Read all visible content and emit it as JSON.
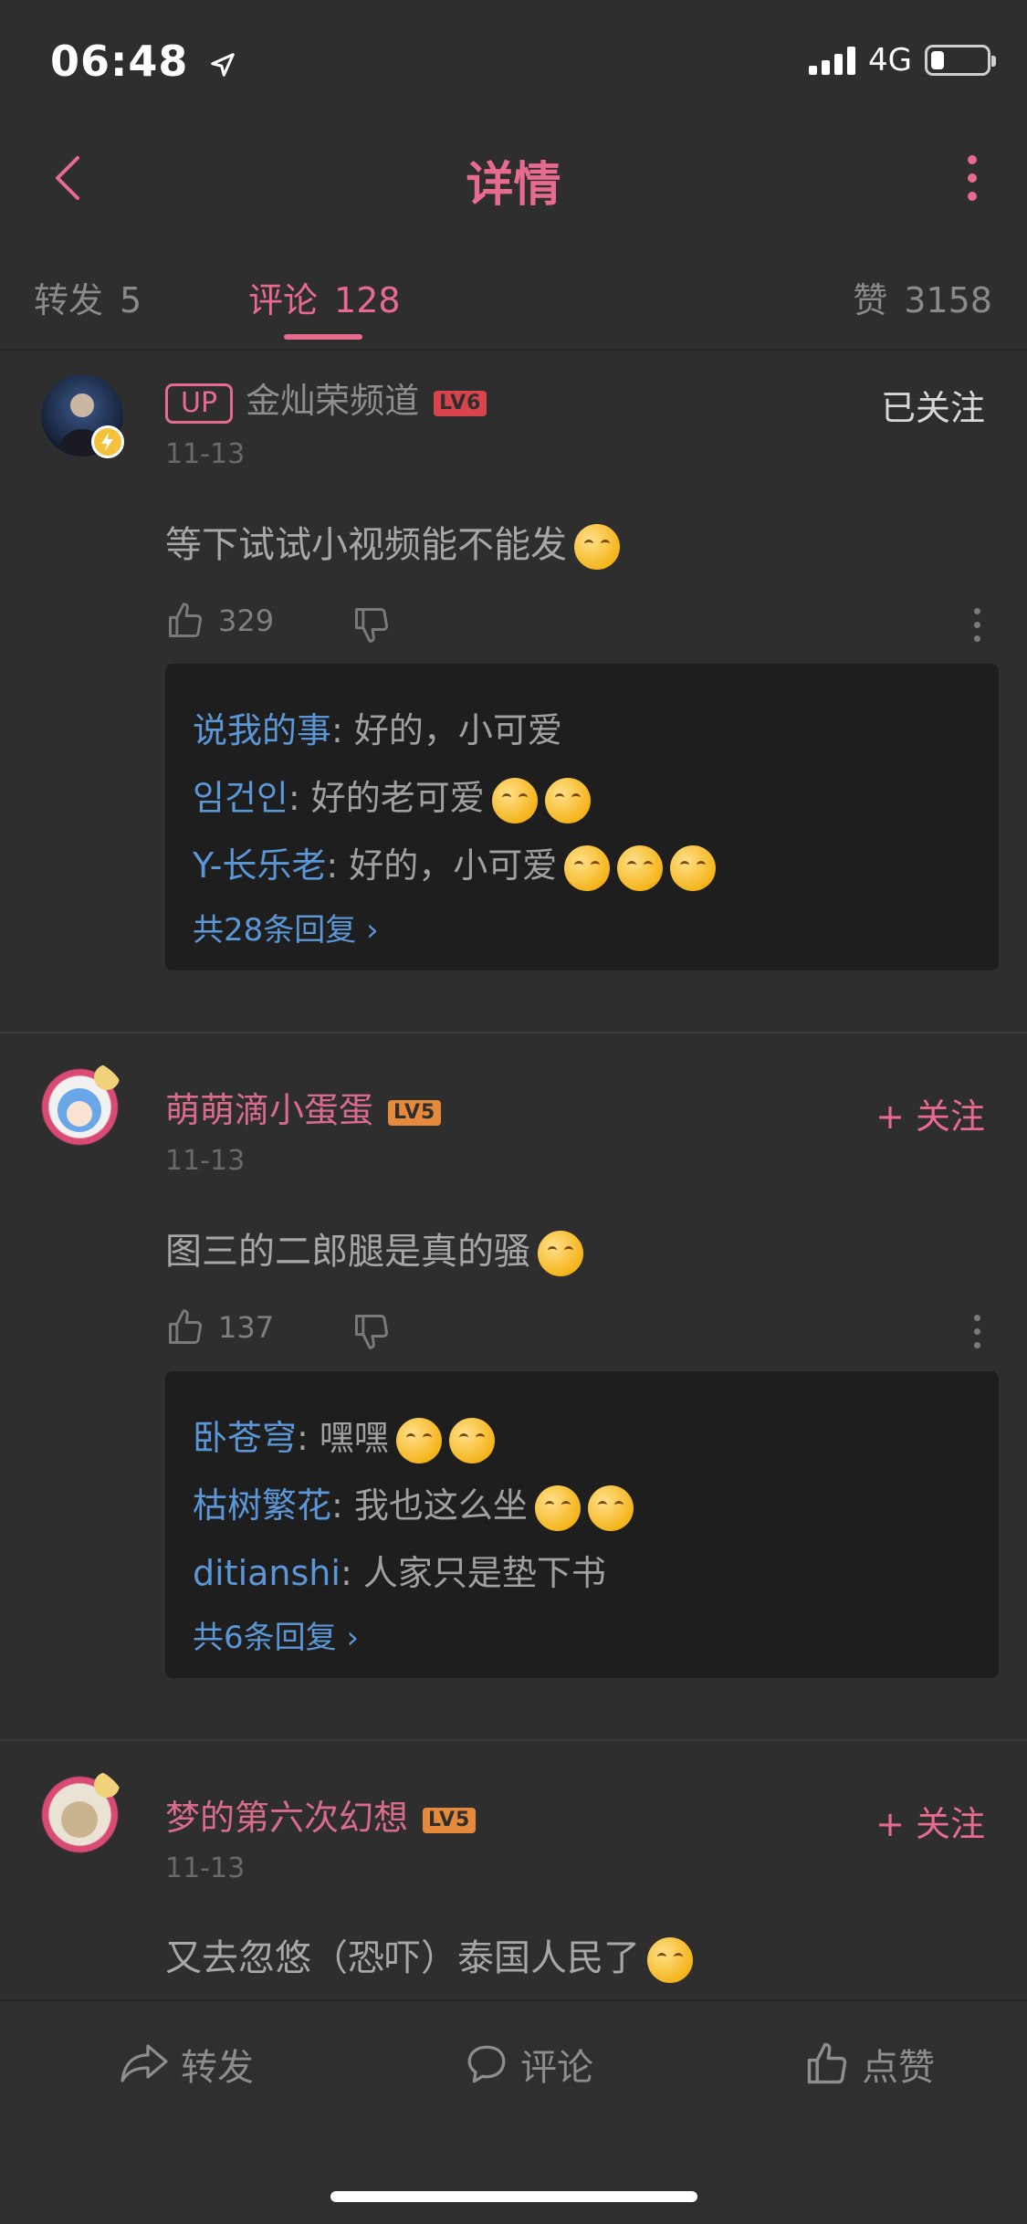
{
  "status": {
    "time": "06:48",
    "network": "4G"
  },
  "header": {
    "title": "详情"
  },
  "tabs": [
    {
      "label": "转发",
      "count": "5"
    },
    {
      "label": "评论",
      "count": "128"
    },
    {
      "label": "赞",
      "count": "3158"
    }
  ],
  "comments": [
    {
      "badge": "UP",
      "author": "金灿荣频道",
      "level": "LV6",
      "date": "11-13",
      "follow": "已关注",
      "text": "等下试试小视频能不能发",
      "likes": "329",
      "replies": [
        {
          "user": "说我的事",
          "text": ": 好的，小可爱"
        },
        {
          "user": "임건인",
          "text": ": 好的老可爱"
        },
        {
          "user": "Y-长乐老",
          "text": ": 好的，小可爱"
        }
      ],
      "more_replies": "共28条回复 ›"
    },
    {
      "author": "萌萌滴小蛋蛋",
      "level": "LV5",
      "date": "11-13",
      "follow": "+ 关注",
      "text": "图三的二郎腿是真的骚",
      "likes": "137",
      "replies": [
        {
          "user": "卧苍穹",
          "text": ": 嘿嘿"
        },
        {
          "user": "枯树繁花",
          "text": ": 我也这么坐"
        },
        {
          "user": "ditianshi",
          "text": ": 人家只是垫下书"
        }
      ],
      "more_replies": "共6条回复 ›"
    },
    {
      "author": "梦的第六次幻想",
      "level": "LV5",
      "date": "11-13",
      "follow": "+ 关注",
      "text": "又去忽悠（恐吓）泰国人民了"
    }
  ],
  "bottom": {
    "repost": "转发",
    "comment": "评论",
    "like": "点赞"
  },
  "colors": {
    "accent": "#e76a8f",
    "reply_user": "#5b97d6",
    "lv6": "#d9434b",
    "lv5": "#e58a3a"
  }
}
